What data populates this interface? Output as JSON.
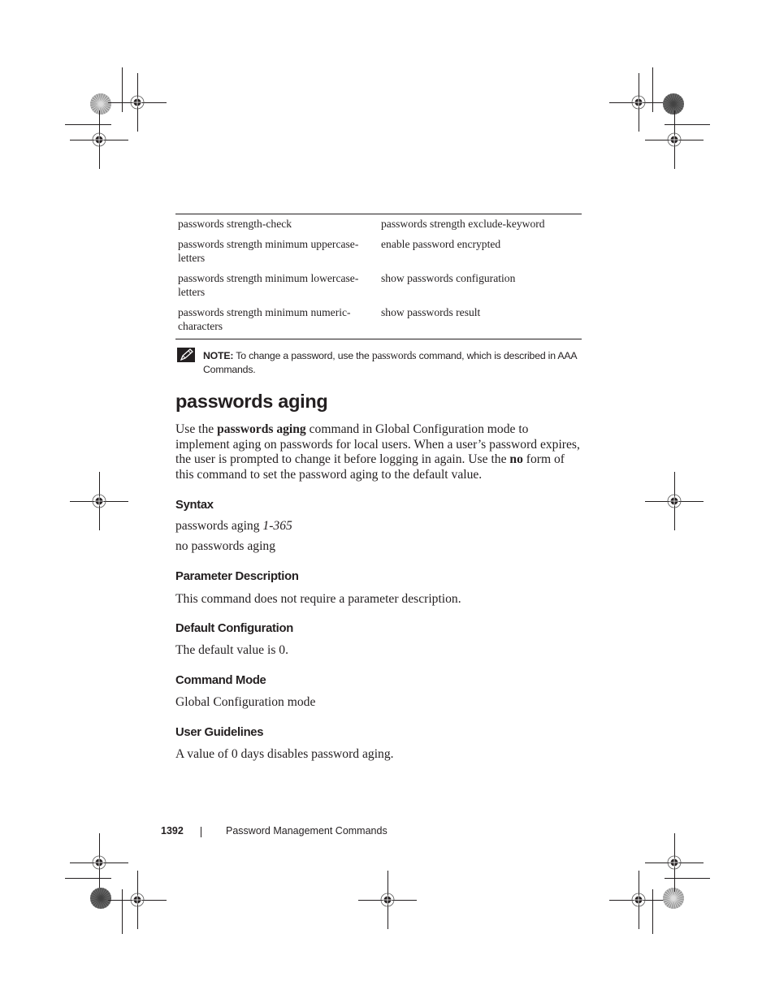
{
  "related_commands_table": {
    "rows": [
      [
        "passwords strength-check",
        "passwords strength exclude-keyword"
      ],
      [
        "passwords strength minimum uppercase-letters",
        "enable password encrypted"
      ],
      [
        "passwords strength minimum lowercase-letters",
        "show passwords configuration"
      ],
      [
        "passwords strength minimum numeric-characters",
        "show passwords result"
      ]
    ],
    "display_rows": [
      [
        "passwords strength-check",
        "passwords strength exclude-keyword"
      ],
      [
        "passwords strength minimum uppercase-\nletters",
        "enable password encrypted"
      ],
      [
        "passwords strength minimum lowercase-\nletters",
        "show passwords configuration"
      ],
      [
        "passwords strength minimum numeric-\ncharacters",
        "show passwords result"
      ]
    ]
  },
  "note": {
    "icon": "pencil-note-icon",
    "label": "NOTE:",
    "text_before": " To change a password, use the ",
    "command": "passwords",
    "text_after": " command, which is described in AAA Commands."
  },
  "section": {
    "title": "passwords aging",
    "intro": {
      "part1": "Use the ",
      "command": "passwords aging",
      "part2": " command in Global Configuration mode to implement aging on passwords for local users. When a user’s password expires, the user is prompted to change it before logging in again. Use the ",
      "no_keyword": "no",
      "part3": " form of this command to set the password aging to the default value."
    },
    "syntax": {
      "heading": "Syntax",
      "line1_command": "passwords aging ",
      "line1_param": "1-365",
      "line2": "no passwords aging"
    },
    "parameter_description": {
      "heading": "Parameter Description",
      "text": "This command does not require a parameter description."
    },
    "default_configuration": {
      "heading": "Default Configuration",
      "text": "The default value is 0."
    },
    "command_mode": {
      "heading": "Command Mode",
      "text": "Global Configuration mode"
    },
    "user_guidelines": {
      "heading": "User Guidelines",
      "text": "A value of 0 days disables password aging."
    }
  },
  "footer": {
    "page_number": "1392",
    "separator": "|",
    "chapter_title": "Password Management Commands"
  }
}
